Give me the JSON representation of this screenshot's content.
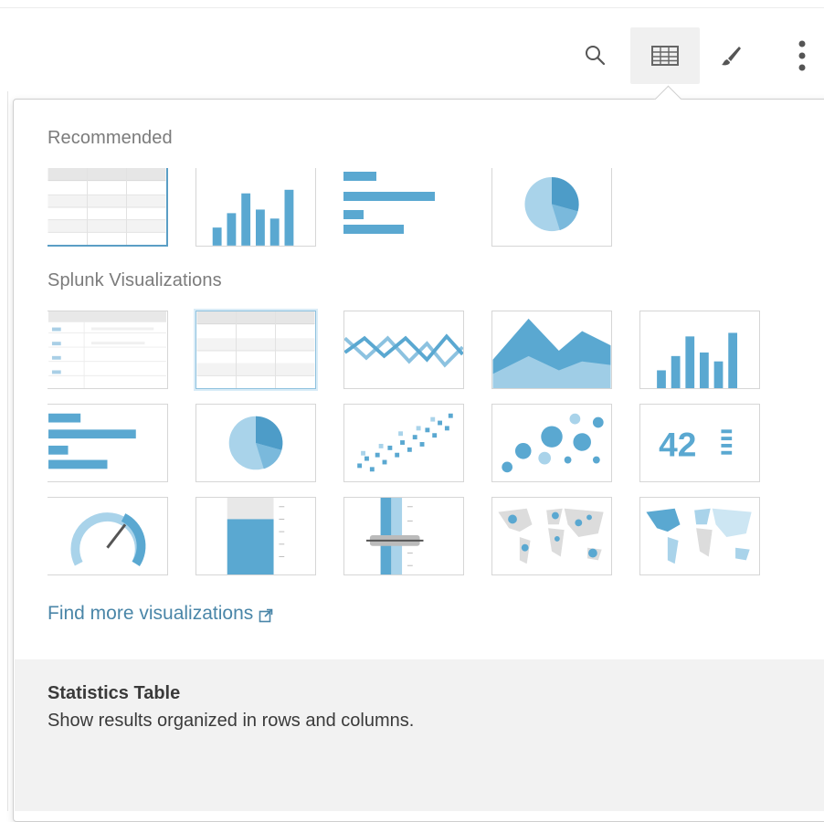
{
  "toolbar": {
    "icons": [
      "search-icon",
      "table-viz-icon",
      "brush-icon",
      "more-vertical-icon"
    ],
    "accent": "#4aa0cf"
  },
  "picker": {
    "recommended_title": "Recommended",
    "splunk_title": "Splunk Visualizations",
    "recommended": [
      "statistics-table",
      "column-chart",
      "bar-chart",
      "pie-chart"
    ],
    "splunk": [
      "events-list",
      "statistics-table",
      "line-chart",
      "area-chart",
      "column-chart",
      "bar-chart",
      "pie-chart",
      "scatter-chart",
      "bubble-chart",
      "single-value",
      "radial-gauge",
      "filler-gauge",
      "marker-gauge",
      "cluster-map",
      "choropleth-map"
    ],
    "single_value_text": "42",
    "find_more_label": "Find more visualizations"
  },
  "info": {
    "title": "Statistics Table",
    "description": "Show results organized in rows and columns."
  }
}
